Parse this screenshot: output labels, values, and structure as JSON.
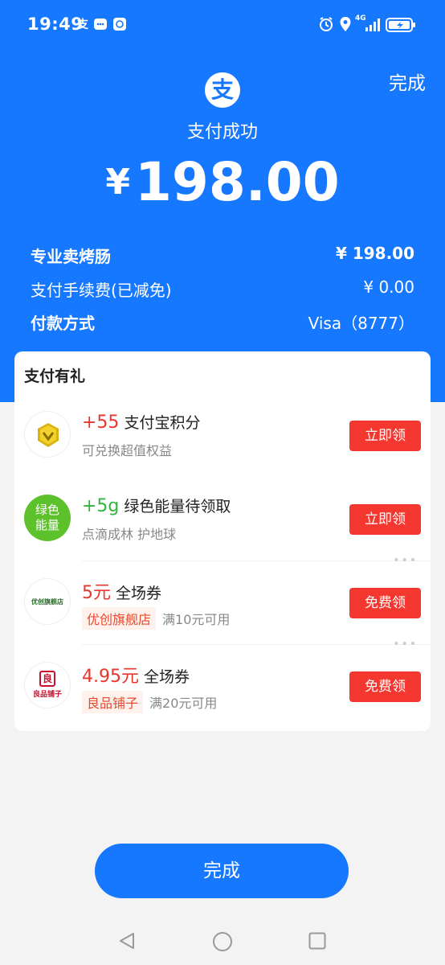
{
  "status_bar": {
    "time": "19:49",
    "glyph_alipay": "支",
    "network": "4G"
  },
  "header": {
    "done_label": "完成",
    "logo_char": "支",
    "success_text": "支付成功",
    "currency": "¥",
    "amount": "198.00"
  },
  "details": [
    {
      "label": "专业卖烤肠",
      "value": "¥ 198.00"
    },
    {
      "label": "支付手续费(已减免)",
      "value": "¥ 0.00"
    },
    {
      "label": "付款方式",
      "value": "Visa（8777）"
    }
  ],
  "gift_card": {
    "title": "支付有礼",
    "items": [
      {
        "highlight": "+55",
        "title": "支付宝积分",
        "tag": "",
        "subtitle": "可兑换超值权益",
        "button": "立即领",
        "logo": "points-coin-icon"
      },
      {
        "highlight": "+5g",
        "title": "绿色能量待领取",
        "tag": "",
        "subtitle": "点滴成林 护地球",
        "button": "立即领",
        "logo_text_1": "绿色",
        "logo_text_2": "能量"
      },
      {
        "highlight": "5元",
        "title": "全场券",
        "tag": "优创旗舰店",
        "subtitle": "满10元可用",
        "button": "免费领",
        "logo_text": "优创旗舰店"
      },
      {
        "highlight": "4.95元",
        "title": "全场券",
        "tag": "良品铺子",
        "subtitle": "满20元可用",
        "button": "免费领",
        "logo_char": "良",
        "logo_text": "良品铺子"
      }
    ]
  },
  "bottom": {
    "done_label": "完成"
  },
  "colors": {
    "brand_blue": "#1677ff",
    "accent_red": "#f5382f",
    "energy_green": "#5cc12a"
  }
}
